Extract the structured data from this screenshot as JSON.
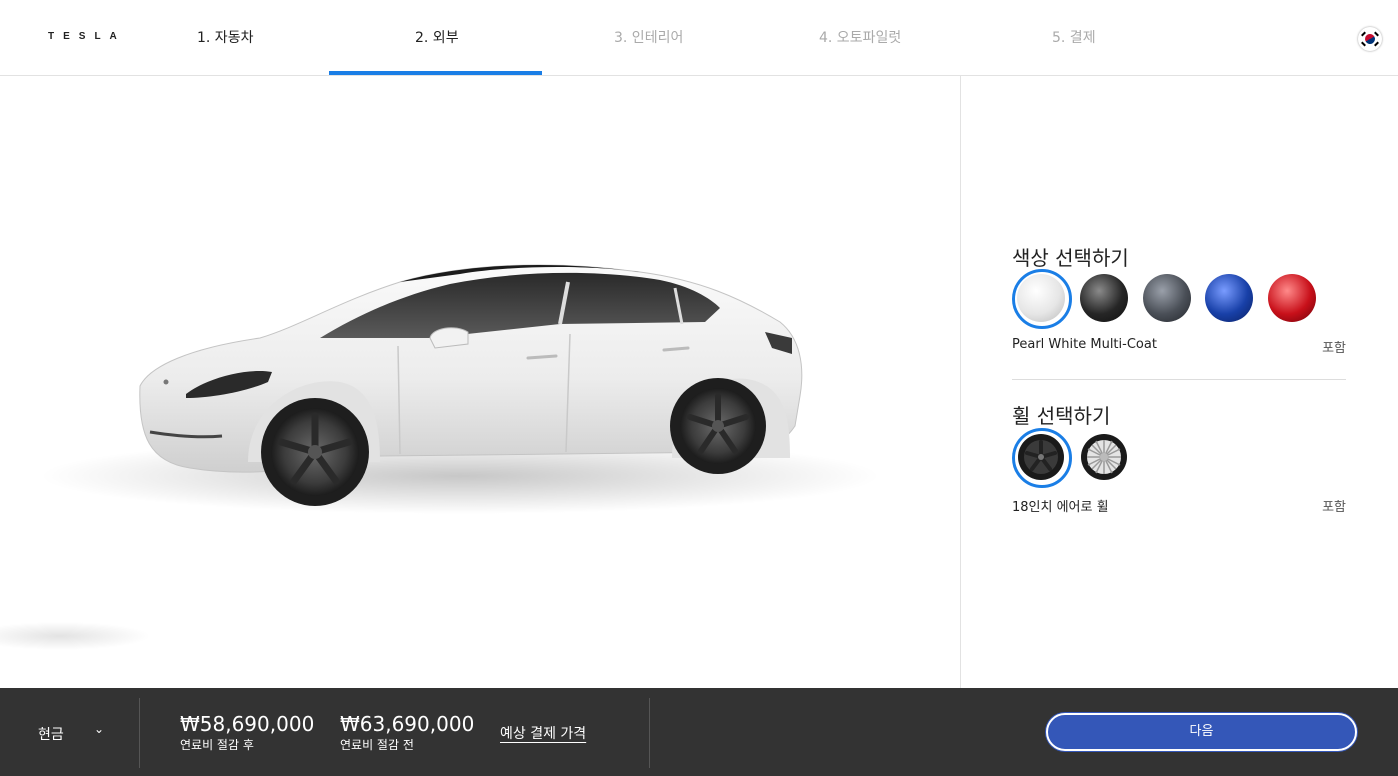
{
  "header": {
    "logo": "TESLA",
    "steps": [
      {
        "label": "1. 자동차",
        "state": "done"
      },
      {
        "label": "2. 외부",
        "state": "active"
      },
      {
        "label": "3. 인테리어",
        "state": "pending"
      },
      {
        "label": "4. 오토파일럿",
        "state": "pending"
      },
      {
        "label": "5. 결제",
        "state": "pending"
      }
    ],
    "flag_icon": "korea-flag-icon"
  },
  "panel": {
    "color_section": {
      "title": "색상 선택하기",
      "selected_name": "Pearl White Multi-Coat",
      "selected_price": "포함",
      "swatches": [
        {
          "name": "pearl-white",
          "color": "#e8e8e8",
          "selected": true
        },
        {
          "name": "solid-black",
          "color": "#222222",
          "selected": false
        },
        {
          "name": "midnight-silver",
          "color": "#4a4f57",
          "selected": false
        },
        {
          "name": "deep-blue",
          "color": "#1840a8",
          "selected": false
        },
        {
          "name": "red-multi-coat",
          "color": "#c8101a",
          "selected": false
        }
      ]
    },
    "wheel_section": {
      "title": "휠 선택하기",
      "selected_name": "18인치 에어로 휠",
      "selected_price": "포함",
      "wheels": [
        {
          "name": "aero-18",
          "selected": true
        },
        {
          "name": "sport-19",
          "selected": false
        }
      ]
    }
  },
  "footer": {
    "payment_type": "현금",
    "price_after": "₩58,690,000",
    "price_after_label": "연료비 절감 후",
    "price_before": "₩63,690,000",
    "price_before_label": "연료비 절감 전",
    "estimate_link": "예상 결제 가격",
    "next_label": "다음"
  },
  "colors": {
    "accent": "#1a7ee6",
    "footer_bg": "#333333",
    "button": "#3457b8"
  }
}
